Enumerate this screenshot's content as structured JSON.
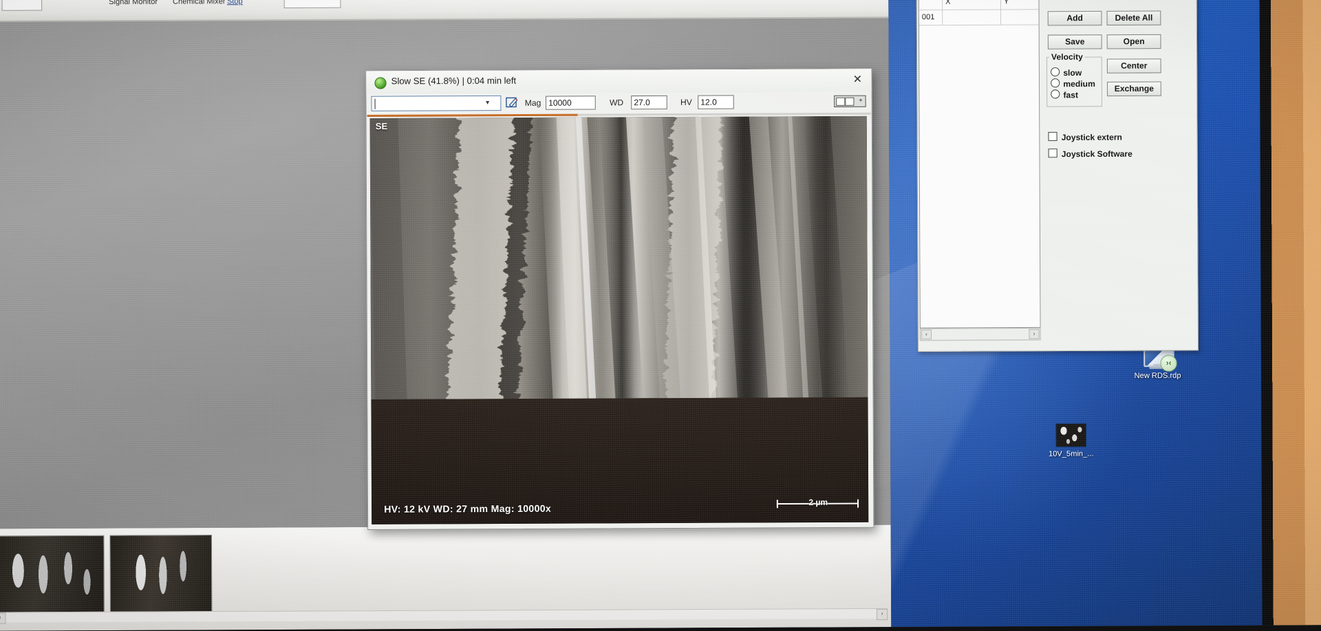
{
  "acquisition_dialog": {
    "status_icon": "green-play-icon",
    "title": "Slow SE (41.8%) | 0:04 min left",
    "close_label": "✕",
    "progress_percent": 41.8,
    "combo_value": "",
    "combo_placeholder": "",
    "edit_icon": "pencil-edit-icon",
    "fields": [
      {
        "label": "Mag",
        "value": "10000"
      },
      {
        "label": "WD",
        "value": "27.0"
      },
      {
        "label": "HV",
        "value": "12.0"
      }
    ],
    "detector_badge": "SE",
    "image_caption": "HV: 12 kV    WD: 27 mm    Mag: 10000x",
    "scalebar_label": "2 µm",
    "layout_button": "split-view-icon"
  },
  "stage_window": {
    "table": {
      "columns": [
        "",
        "X",
        "Y"
      ],
      "rows": [
        {
          "id": "001",
          "x": "",
          "y": ""
        }
      ]
    },
    "buttons": [
      {
        "label": "Add"
      },
      {
        "label": "Delete All"
      },
      {
        "label": "Save"
      },
      {
        "label": "Open"
      },
      {
        "label": "Center"
      },
      {
        "label": "Exchange"
      }
    ],
    "velocity": {
      "group_label": "Velocity",
      "options": [
        "slow",
        "medium",
        "fast"
      ],
      "selected": ""
    },
    "checkboxes": [
      {
        "label": "Joystick extern",
        "checked": false
      },
      {
        "label": "Joystick Software",
        "checked": false
      }
    ],
    "scroll_left": "‹",
    "scroll_right": "›"
  },
  "top_strip": {
    "labels": [
      "Signal Monitor",
      "Chemical Mixer"
    ],
    "link": "Stop"
  },
  "filmstrip": {
    "thumbnail_count": 2,
    "scroll_left": "‹",
    "scroll_right": "›"
  },
  "desktop": {
    "icons": [
      {
        "name": "New RDS.rdp",
        "glyph": "remote-desktop-icon"
      },
      {
        "name": "10V_5min_...",
        "glyph": "image-file-icon"
      }
    ]
  },
  "colors": {
    "accent_progress": "#c06a23",
    "desktop_blue": "#1b4fae",
    "dialog_bg": "#f0f1ef",
    "app_canvas": "#909090",
    "wall": "#d79a5e"
  }
}
